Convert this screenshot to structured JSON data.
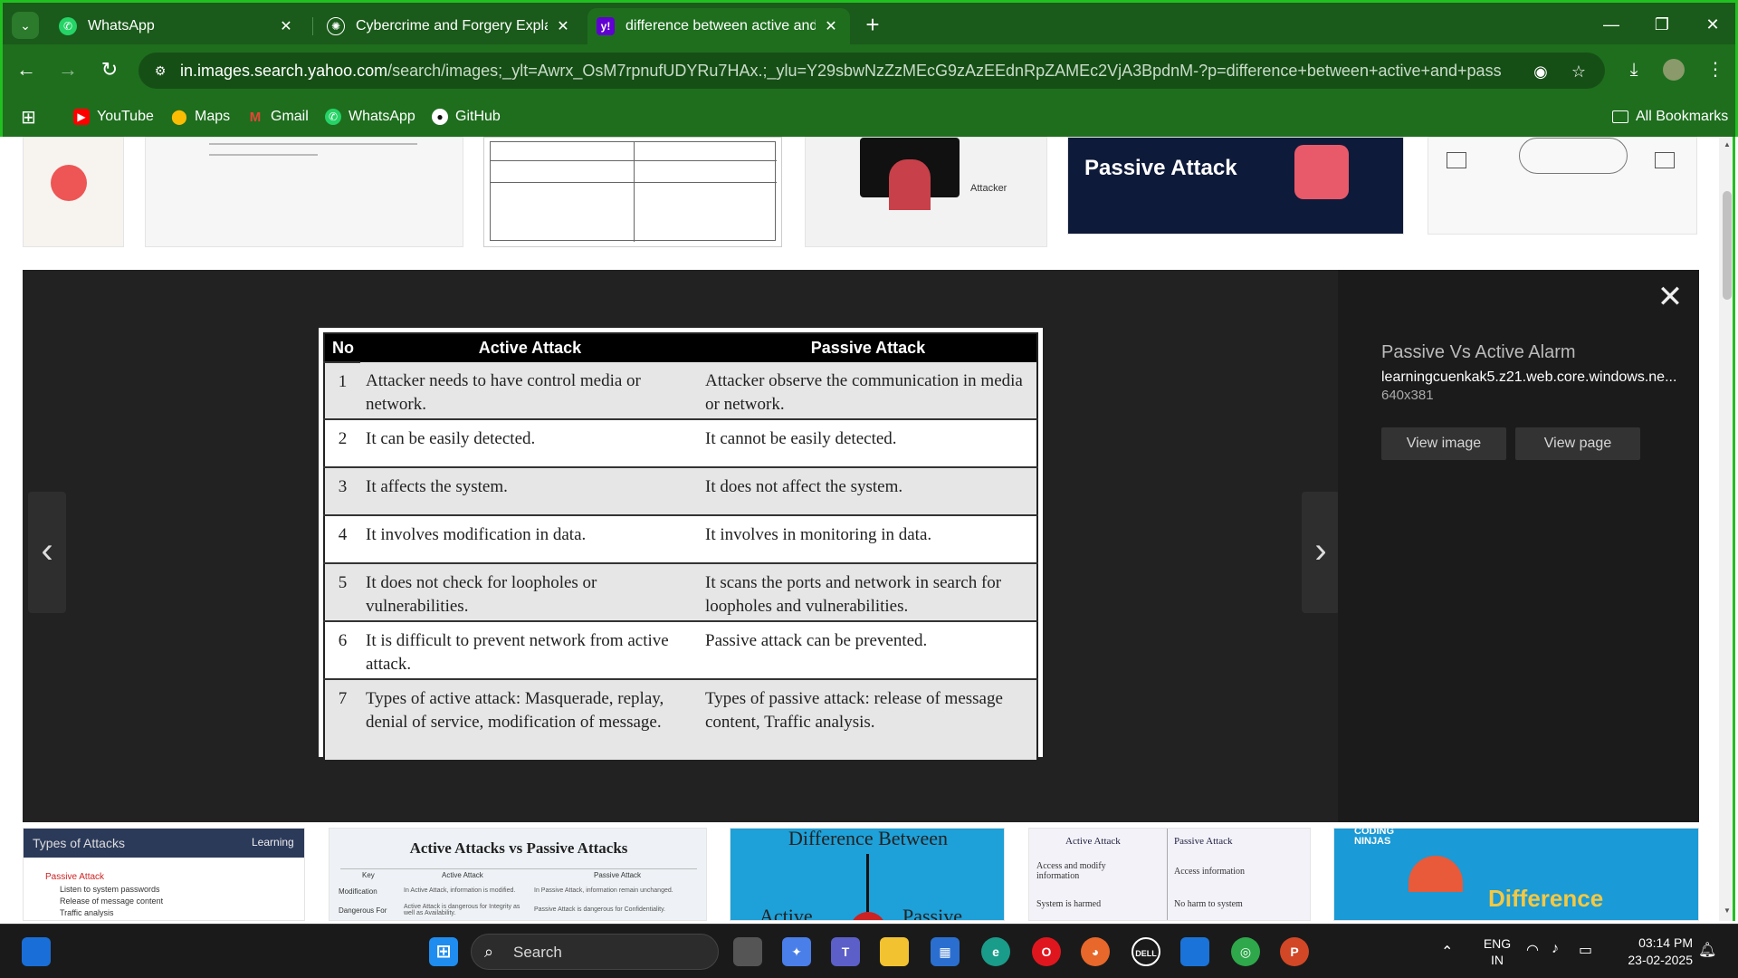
{
  "browser": {
    "tabs": [
      {
        "title": "WhatsApp",
        "active": false,
        "icon": "whatsapp-icon"
      },
      {
        "title": "Cybercrime and Forgery Explain",
        "active": false,
        "icon": "openai-icon"
      },
      {
        "title": "difference between active and p",
        "active": true,
        "icon": "yahoo-icon"
      }
    ],
    "url_host": "in.images.search.yahoo.com",
    "url_path": "/search/images;_ylt=Awrx_OsM7rpnufUDYRu7HAx.;_ylu=Y29sbwNzZzMEcG9zAzEEdnRpZAMEc2VjA3BpdnM-?p=difference+between+active+and+passive+attack...",
    "bookmarks": [
      "YouTube",
      "Maps",
      "Gmail",
      "WhatsApp",
      "GitHub"
    ],
    "all_bookmarks_label": "All Bookmarks"
  },
  "preview": {
    "title": "Passive Vs Active Alarm",
    "source": "learningcuenkak5.z21.web.core.windows.ne...",
    "size": "640x381",
    "view_image_label": "View image",
    "view_page_label": "View page"
  },
  "attack_table": {
    "headers": [
      "No",
      "Active Attack",
      "Passive Attack"
    ],
    "rows": [
      {
        "no": "1",
        "active": "Attacker needs to have control media or network.",
        "passive": "Attacker observe the communication in media or network."
      },
      {
        "no": "2",
        "active": "It can be easily detected.",
        "passive": "It cannot be easily detected."
      },
      {
        "no": "3",
        "active": "It affects the system.",
        "passive": "It does not affect the system."
      },
      {
        "no": "4",
        "active": "It involves modification in data.",
        "passive": "It involves in monitoring in data."
      },
      {
        "no": "5",
        "active": "It does not check for loopholes or vulnerabilities.",
        "passive": "It scans the ports and network in search for loopholes and vulnerabilities."
      },
      {
        "no": "6",
        "active": "It is difficult to prevent network from active attack.",
        "passive": "Passive attack can be prevented."
      },
      {
        "no": "7",
        "active": "Types of active attack: Masquerade, replay, denial of service, modification of message.",
        "passive": "Types of passive attack: release of message content, Traffic analysis."
      }
    ]
  },
  "top_thumbs": {
    "passive_attack_label": "Passive Attack",
    "attacker_label": "Attacker"
  },
  "bottom_thumbs": {
    "types_of_attacks": "Types of Attacks",
    "types_passive": "Passive Attack",
    "types_items": [
      "Listen to system passwords",
      "Release of message content",
      "Traffic analysis"
    ],
    "learning_logo": "Learning",
    "active_vs_passive_title": "Active Attacks vs Passive Attacks",
    "avp_headers": [
      "Key",
      "Active Attack",
      "Passive Attack"
    ],
    "avp_rows": [
      [
        "Modification",
        "In Active Attack, information is modified.",
        "In Passive Attack, information remain unchanged."
      ],
      [
        "Dangerous For",
        "Active Attack is dangerous for Integrity as well as Availability.",
        "Passive Attack is dangerous for Confidentiality."
      ]
    ],
    "difference_between": "Difference Between",
    "active_word": "Active",
    "passive_word": "Passive",
    "mini_headers": [
      "Active Attack",
      "Passive Attack"
    ],
    "mini_rows": [
      [
        "Access and modify information",
        "Access information"
      ],
      [
        "System  is harmed",
        "No harm to system"
      ]
    ],
    "coding_ninjas": "CODING NINJAS",
    "difference_word": "Difference"
  },
  "taskbar": {
    "search_placeholder": "Search",
    "lang_top": "ENG",
    "lang_bottom": "IN",
    "time": "03:14 PM",
    "date": "23-02-2025"
  },
  "colors": {
    "chrome_green": "#1e6e1e",
    "tab_bar_green": "#1a5a1a",
    "frame_green": "#20c020",
    "lightbox_bg": "#1e1e1e"
  }
}
